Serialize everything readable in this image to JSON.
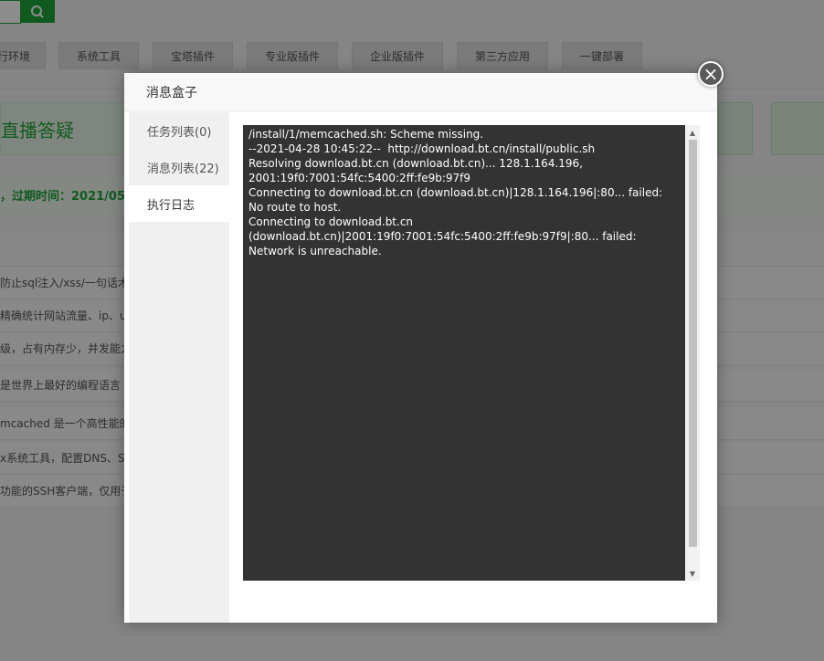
{
  "background": {
    "tabs": [
      "行环境",
      "系统工具",
      "宝塔插件",
      "专业版插件",
      "企业版插件",
      "第三方应用",
      "一键部署"
    ],
    "banner_text": "直播答疑",
    "notice_text": "，过期时间：2021/05/",
    "rows": [
      "防止sql注入/xss/一句话木",
      "精确统计网站流量、ip、u",
      "级，占有内存少，并发能力",
      "是世界上最好的编程语言",
      "mcached 是一个高性能的分",
      "x系统工具，配置DNS、S",
      "功能的SSH客户端，仅用于"
    ]
  },
  "dialog": {
    "title": "消息盒子",
    "close_label": "×",
    "sidebar": [
      {
        "label": "任务列表(0)"
      },
      {
        "label": "消息列表(22)"
      },
      {
        "label": "执行日志"
      }
    ],
    "log_text": "/install/1/memcached.sh: Scheme missing.\n--2021-04-28 10:45:22--  http://download.bt.cn/install/public.sh\nResolving download.bt.cn (download.bt.cn)... 128.1.164.196, 2001:19f0:7001:54fc:5400:2ff:fe9b:97f9\nConnecting to download.bt.cn (download.bt.cn)|128.1.164.196|:80... failed: No route to host.\nConnecting to download.bt.cn (download.bt.cn)|2001:19f0:7001:54fc:5400:2ff:fe9b:97f9|:80... failed: Network is unreachable."
  },
  "icons": {
    "search": "search-icon",
    "close": "close-icon",
    "scroll_up": "arrow-up-icon",
    "scroll_down": "arrow-down-icon"
  }
}
